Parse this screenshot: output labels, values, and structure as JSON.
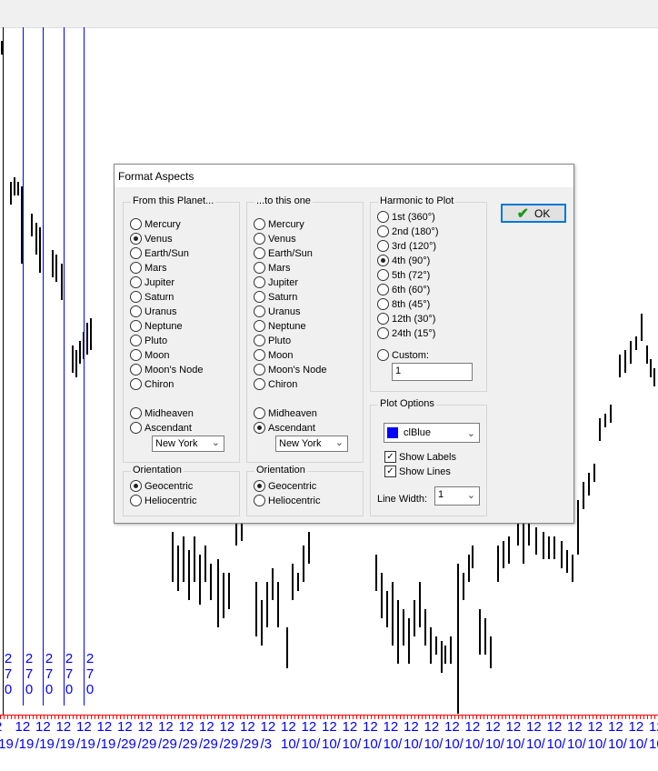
{
  "chart": {
    "aspect_lines": [
      {
        "label": "270"
      },
      {
        "label": "270"
      },
      {
        "label": "270"
      },
      {
        "label": "270"
      },
      {
        "label": "270"
      }
    ],
    "x_hours": [
      "2",
      "12",
      "12",
      "12",
      "12",
      "12",
      "12",
      "12",
      "12",
      "12",
      "12",
      "12",
      "12",
      "12",
      "12",
      "12",
      "12",
      "12",
      "12",
      "12",
      "12",
      "12",
      "12",
      "12",
      "12",
      "12",
      "12",
      "12",
      "12",
      "12",
      "12",
      "12",
      "12"
    ],
    "x_dates": [
      "/19",
      "/19",
      "/19",
      "/19",
      "/19",
      "/19",
      "/29",
      "/29",
      "/29",
      "/29",
      "/29",
      "/29",
      "/29",
      "/3",
      "10/",
      "10/",
      "10/",
      "10/",
      "10/",
      "10/",
      "10/",
      "10/",
      "10/",
      "10/",
      "10/",
      "10/",
      "10/",
      "10/",
      "10/",
      "10/",
      "10/",
      "10/",
      "10"
    ],
    "line_color": "#0000ff",
    "axis_color": "#ff0000"
  },
  "dialog": {
    "title": "Format Aspects",
    "from": {
      "label": "From this Planet...",
      "planets": [
        "Mercury",
        "Venus",
        "Earth/Sun",
        "Mars",
        "Jupiter",
        "Saturn",
        "Uranus",
        "Neptune",
        "Pluto",
        "Moon",
        "Moon's Node",
        "Chiron"
      ],
      "extra": [
        "Midheaven",
        "Ascendant"
      ],
      "selected": "Venus",
      "location": "New York",
      "orientation_label": "Orientation",
      "orientations": [
        "Geocentric",
        "Heliocentric"
      ],
      "orientation_selected": "Geocentric"
    },
    "to": {
      "label": "...to this one",
      "planets": [
        "Mercury",
        "Venus",
        "Earth/Sun",
        "Mars",
        "Jupiter",
        "Saturn",
        "Uranus",
        "Neptune",
        "Pluto",
        "Moon",
        "Moon's Node",
        "Chiron"
      ],
      "extra": [
        "Midheaven",
        "Ascendant"
      ],
      "selected": "Ascendant",
      "location": "New York",
      "orientation_label": "Orientation",
      "orientations": [
        "Geocentric",
        "Heliocentric"
      ],
      "orientation_selected": "Geocentric"
    },
    "harmonic": {
      "label": "Harmonic to Plot",
      "options": [
        "1st (360°)",
        "2nd (180°)",
        "3rd (120°)",
        "4th (90°)",
        "5th (72°)",
        "6th (60°)",
        "8th (45°)",
        "12th (30°)",
        "24th (15°)"
      ],
      "selected": "4th (90°)",
      "custom_label": "Custom:",
      "custom_value": "1"
    },
    "plot_options": {
      "label": "Plot Options",
      "color_name": "clBlue",
      "color": "#0000ff",
      "show_labels_label": "Show Labels",
      "show_labels": true,
      "show_lines_label": "Show Lines",
      "show_lines": true,
      "line_width_label": "Line Width:",
      "line_width": "1"
    },
    "ok_label": "OK"
  }
}
